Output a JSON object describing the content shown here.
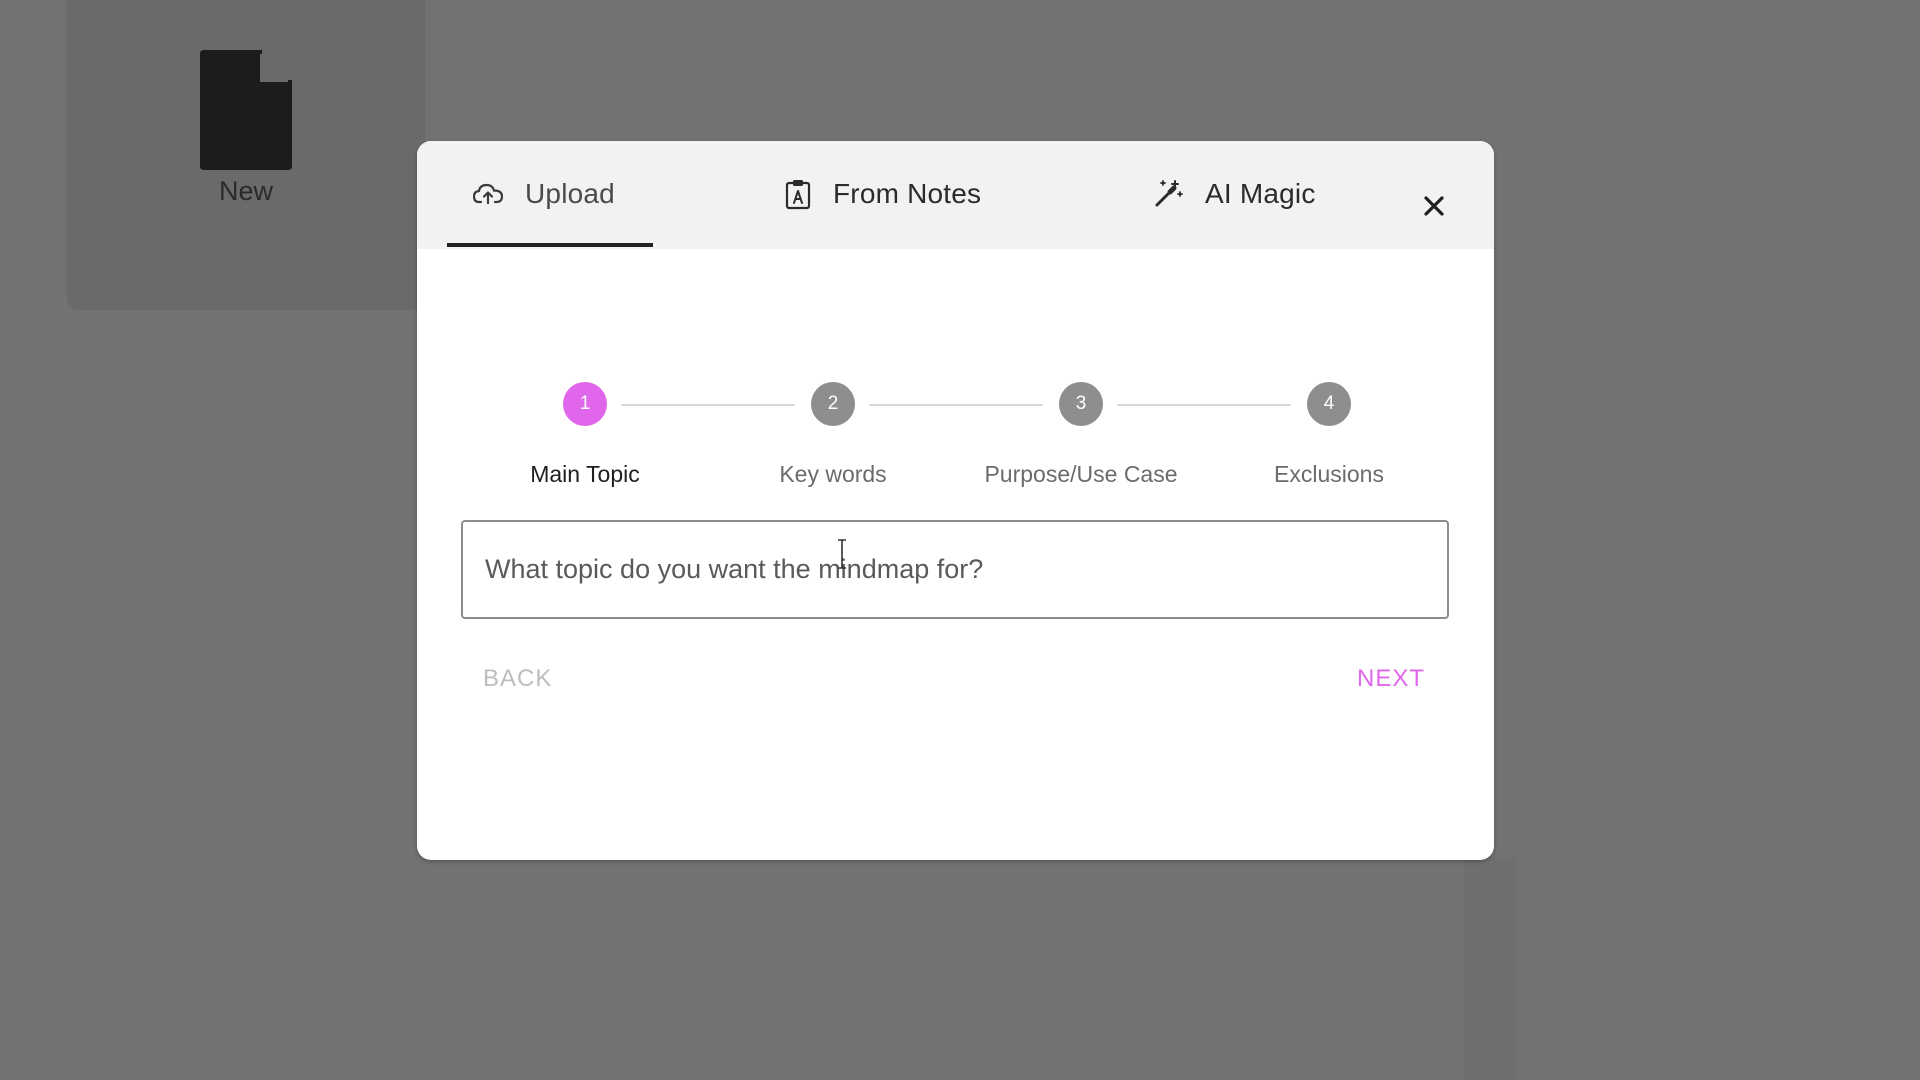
{
  "background": {
    "new_card": {
      "label": "New"
    }
  },
  "modal": {
    "tabs": [
      {
        "label": "Upload",
        "icon": "cloud-upload-icon",
        "active": true
      },
      {
        "label": "From Notes",
        "icon": "clipboard-icon",
        "active": false
      },
      {
        "label": "AI Magic",
        "icon": "magic-wand-icon",
        "active": false
      }
    ],
    "close_icon": "close-icon",
    "stepper": {
      "steps": [
        {
          "number": "1",
          "label": "Main Topic",
          "active": true
        },
        {
          "number": "2",
          "label": "Key words",
          "active": false
        },
        {
          "number": "3",
          "label": "Purpose/Use Case",
          "active": false
        },
        {
          "number": "4",
          "label": "Exclusions",
          "active": false
        }
      ]
    },
    "topic_input": {
      "value": "",
      "placeholder": "What topic do you want the mindmap for?"
    },
    "back_label": "BACK",
    "next_label": "NEXT"
  },
  "colors": {
    "accent": "#e066ec",
    "inactive_step": "#8e8e8e",
    "backdrop": "#727272",
    "disabled_text": "#bdbdbd"
  }
}
